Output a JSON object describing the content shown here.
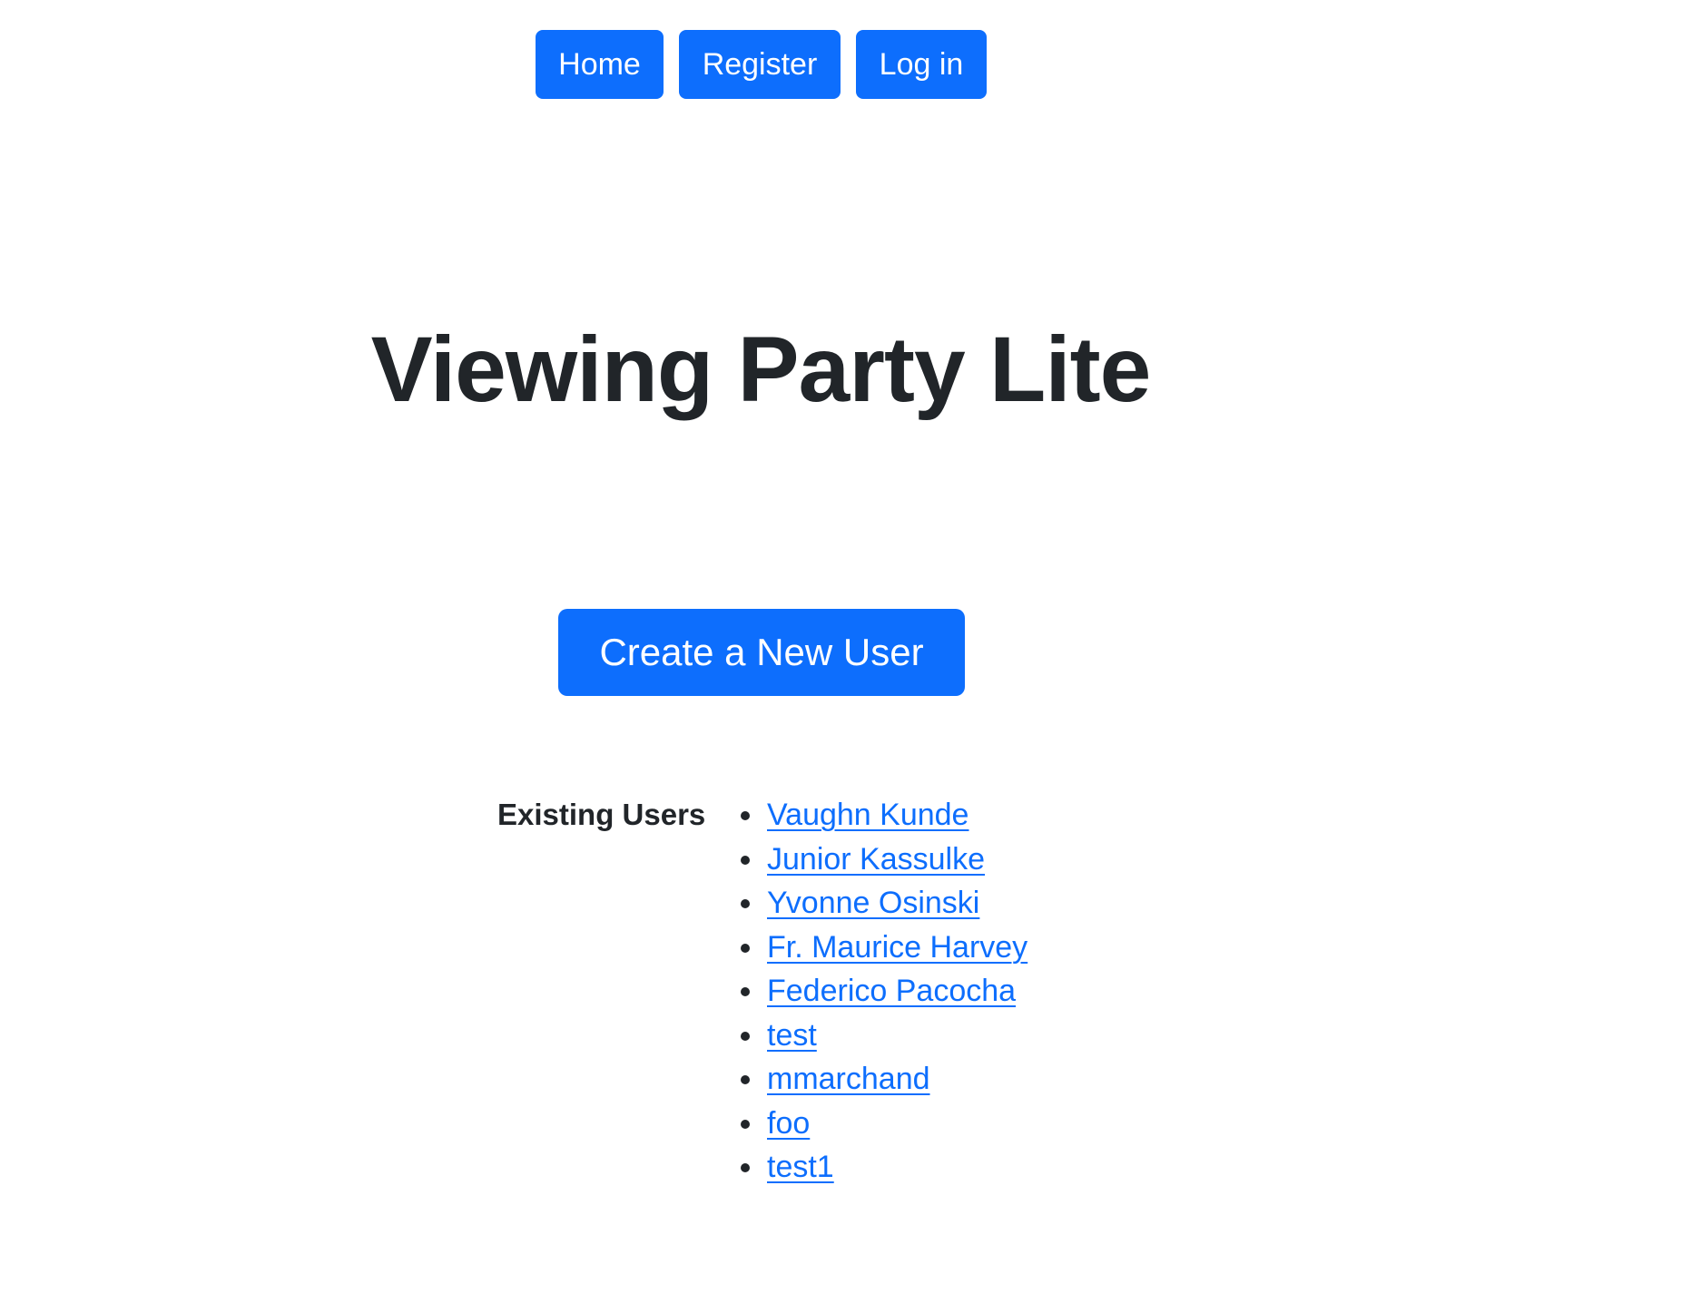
{
  "nav": {
    "home_label": "Home",
    "register_label": "Register",
    "login_label": "Log in"
  },
  "page": {
    "title": "Viewing Party Lite"
  },
  "actions": {
    "create_user_label": "Create a New User"
  },
  "users": {
    "heading": "Existing Users",
    "items": [
      "Vaughn Kunde",
      "Junior Kassulke",
      "Yvonne Osinski",
      "Fr. Maurice Harvey",
      "Federico Pacocha",
      "test",
      "mmarchand",
      "foo",
      "test1"
    ]
  },
  "colors": {
    "accent": "#0d6efd",
    "text": "#212529",
    "background": "#ffffff"
  }
}
